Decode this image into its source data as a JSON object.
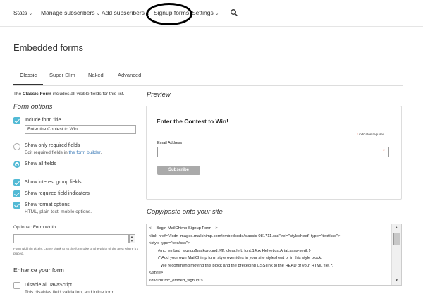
{
  "nav": {
    "items": [
      {
        "label": "Stats",
        "caret": true
      },
      {
        "label": "Manage subscribers",
        "caret": true
      },
      {
        "label": "Add subscribers",
        "caret": true
      },
      {
        "label": "Signup forms",
        "caret": false
      },
      {
        "label": "Settings",
        "caret": true
      }
    ],
    "search_icon": "search-icon"
  },
  "page": {
    "title": "Embedded forms"
  },
  "tabs": [
    {
      "label": "Classic",
      "active": true
    },
    {
      "label": "Super Slim",
      "active": false
    },
    {
      "label": "Naked",
      "active": false
    },
    {
      "label": "Advanced",
      "active": false
    }
  ],
  "intro": {
    "prefix": "The ",
    "bold": "Classic Form",
    "suffix": " includes all visible fields for this list."
  },
  "form_options": {
    "heading": "Form options",
    "include_title": {
      "label": "Include form title",
      "checked": true,
      "value": "Enter the Contest to Win!"
    },
    "show_required": {
      "label": "Show only required fields",
      "sub_prefix": "Edit required fields in ",
      "sub_link": "the form builder",
      "sub_suffix": ".",
      "selected": false
    },
    "show_all": {
      "label": "Show all fields",
      "selected": true
    },
    "interest_groups": {
      "label": "Show interest group fields",
      "checked": true
    },
    "required_indicators": {
      "label": "Show required field indicators",
      "checked": true
    },
    "format_options": {
      "label": "Show format options",
      "sub": "HTML, plain-text, mobile options.",
      "checked": true
    }
  },
  "form_width": {
    "optional": "Optional: ",
    "label": "Form width",
    "value": "",
    "helper": "Form width in pixels. Leave blank to let the form take on the width of the area where it's placed."
  },
  "enhance": {
    "heading": "Enhance your form",
    "disable_js": {
      "label": "Disable all JavaScript",
      "sub": "This disables field validation, and inline form",
      "checked": false
    }
  },
  "preview": {
    "heading": "Preview",
    "title": "Enter the Contest to Win!",
    "required_star": "*",
    "required_text": " indicates required",
    "email_label": "Email Address",
    "email_star": "*",
    "button": "Subscribe"
  },
  "copy": {
    "heading": "Copy/paste onto your site",
    "lines": [
      "<!-- Begin MailChimp Signup Form -->",
      "<link href=\"//cdn-images.mailchimp.com/embedcode/classic-081711.css\" rel=\"stylesheet\" type=\"text/css\">",
      "<style type=\"text/css\">",
      "    #mc_embed_signup{background:#fff; clear:left; font:14px Helvetica,Arial,sans-serif; }",
      "    /* Add your own MailChimp form style overrides in your site stylesheet or in this style block.",
      "       We recommend moving this block and the preceding CSS link to the HEAD of your HTML file. */",
      "</style>",
      "<div id=\"mc_embed_signup\">"
    ]
  },
  "colors": {
    "accent": "#52bad5",
    "link": "#3a7ab7",
    "required": "#e85c41",
    "annotation": "#000000"
  }
}
